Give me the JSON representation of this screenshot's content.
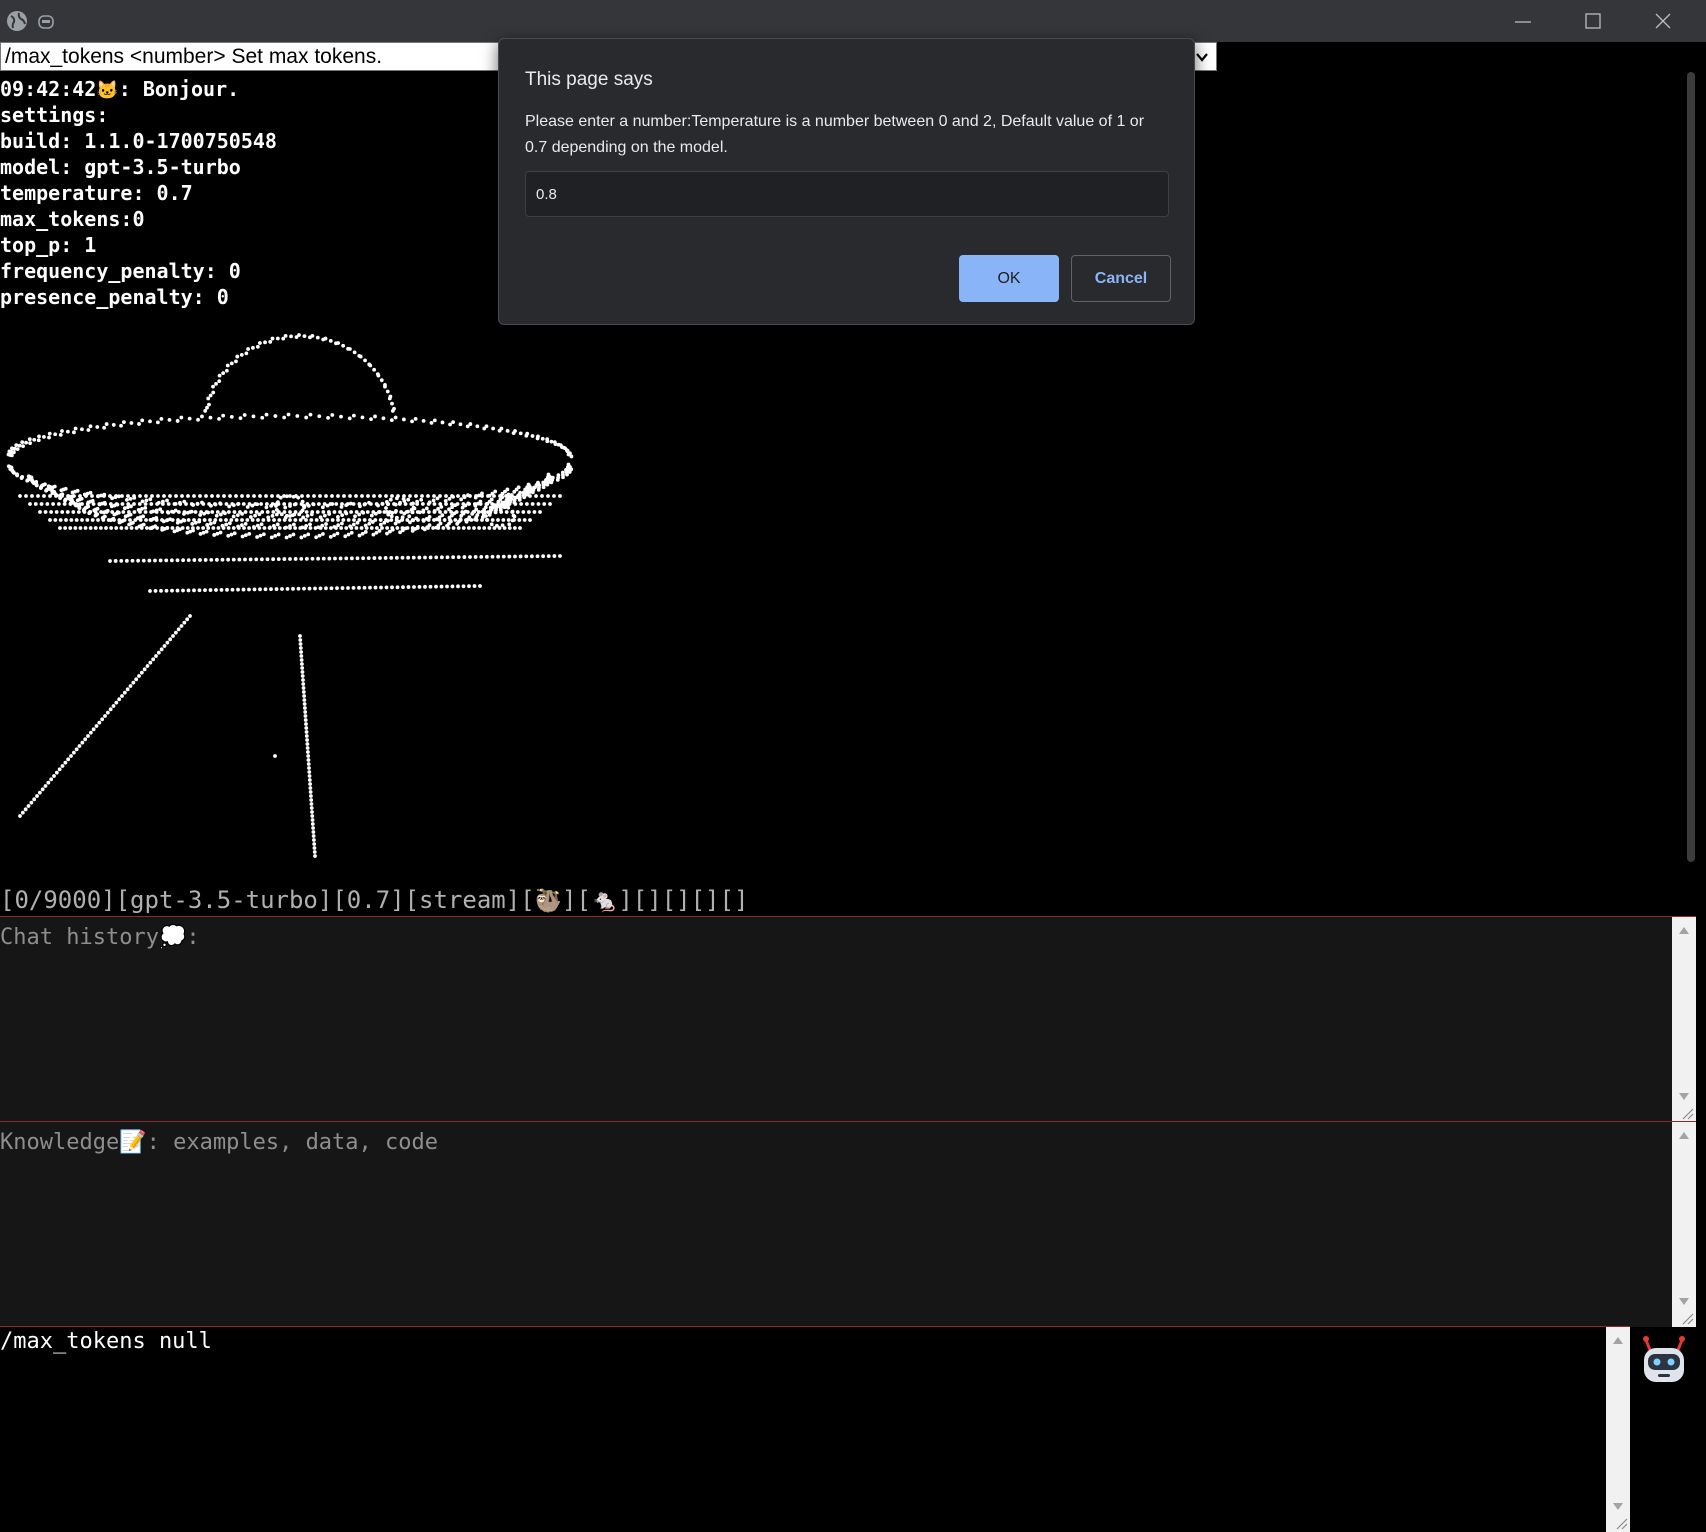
{
  "titlebar": {
    "icons": [
      "globe-icon",
      "extension-icon"
    ],
    "controls": [
      "minimize-icon",
      "maximize-icon",
      "close-icon"
    ]
  },
  "command_select": {
    "selected": "/max_tokens <number> Set max tokens."
  },
  "output": {
    "greeting_time": "09:42:42",
    "greeting_emoji": "🐱",
    "greeting_text": ": Bonjour.",
    "settings_lines": [
      "settings:",
      "build: 1.1.0-1700750548",
      "model: gpt-3.5-turbo",
      "temperature: 0.7",
      "max_tokens:0",
      "top_p: 1",
      "frequency_penalty: 0",
      "presence_penalty: 0"
    ]
  },
  "status_line": {
    "tokens": "[0/9000]",
    "model": "[gpt-3.5-turbo]",
    "temperature": "[0.7]",
    "mode": "[stream]",
    "emoji1": "🦥",
    "emoji2": "🐁",
    "tail": "][][][][]"
  },
  "chat_history": {
    "placeholder_label": "Chat history",
    "placeholder_emoji": "💭",
    "placeholder_suffix": ":"
  },
  "knowledge": {
    "placeholder_label": "Knowledge",
    "placeholder_emoji": "📝",
    "placeholder_suffix": ": examples, data, code"
  },
  "input": {
    "value": "/max_tokens null"
  },
  "dialog": {
    "title": "This page says",
    "message": "Please enter a number:Temperature is a number between 0 and 2, Default value of 1 or 0.7 depending on the model.",
    "input_value": "0.8",
    "ok_label": "OK",
    "cancel_label": "Cancel"
  },
  "colors": {
    "dialog_bg": "#292a2d",
    "ok_accent": "#8ab4f8",
    "pane_border": "#8a2b2b"
  }
}
